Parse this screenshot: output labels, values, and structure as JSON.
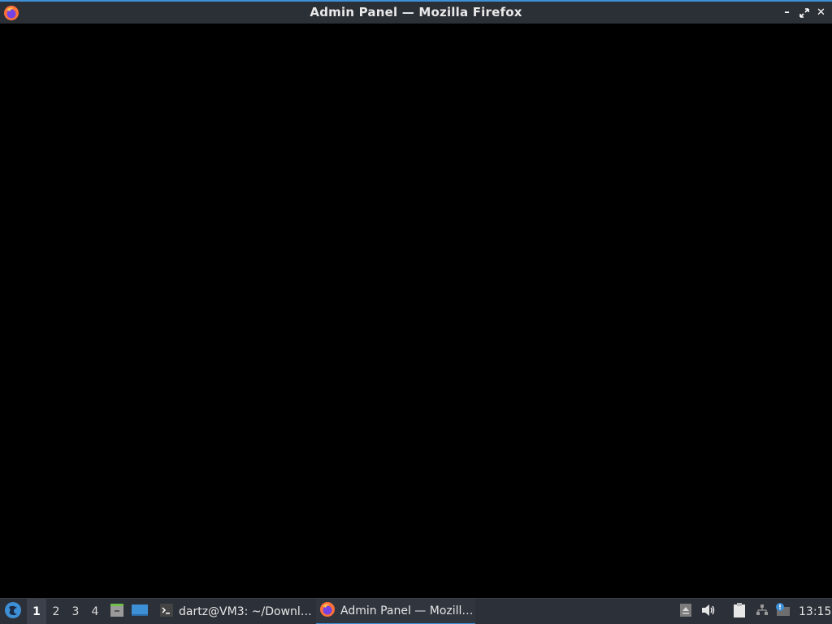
{
  "window": {
    "title": "Admin Panel — Mozilla Firefox",
    "icon": "firefox-icon",
    "controls": {
      "minimize_icon": "minimize-icon",
      "maximize_icon": "maximize-icon",
      "close_icon": "close-icon"
    }
  },
  "colors": {
    "accent": "#3d8fd6",
    "titlebar_bg": "#2b2f36",
    "taskbar_bg": "#2c3038",
    "content_bg": "#000000"
  },
  "taskbar": {
    "start_icon": "start-menu-icon",
    "workspaces": [
      "1",
      "2",
      "3",
      "4"
    ],
    "active_workspace": "1",
    "launchers": [
      "file-manager-icon",
      "show-desktop-icon"
    ],
    "tasks": [
      {
        "icon": "terminal-icon",
        "label": "dartz@VM3: ~/Downl…"
      },
      {
        "icon": "firefox-icon",
        "label": "Admin Panel — Mozill…"
      }
    ],
    "tray": [
      "eject-icon",
      "volume-icon",
      "clipboard-icon",
      "network-icon",
      "update-notifier-icon"
    ],
    "clock": "13:15"
  }
}
